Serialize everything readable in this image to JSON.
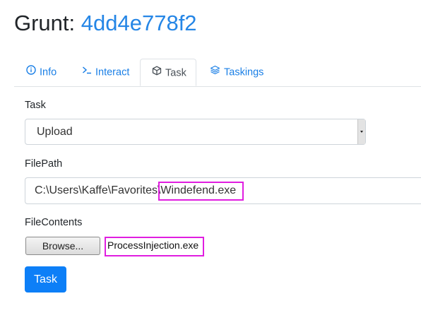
{
  "header": {
    "prefix": "Grunt: ",
    "grunt_id": "4dd4e778f2"
  },
  "tabs": [
    {
      "label": "Info",
      "icon": "info-circle-icon",
      "active": false
    },
    {
      "label": "Interact",
      "icon": "terminal-prompt-icon",
      "active": false
    },
    {
      "label": "Task",
      "icon": "cube-icon",
      "active": true
    },
    {
      "label": "Taskings",
      "icon": "layers-icon",
      "active": false
    }
  ],
  "form": {
    "task_label": "Task",
    "task_value": "Upload",
    "filepath_label": "FilePath",
    "filepath_value": "C:\\Users\\Kaffe\\Favorites\\Windefend.exe",
    "filecontents_label": "FileContents",
    "browse_label": "Browse...",
    "file_name": "ProcessInjection.exe",
    "submit_label": "Task"
  },
  "colors": {
    "accent": "#2586e6",
    "highlight": "#e01ee0",
    "button": "#0d7ff7"
  }
}
